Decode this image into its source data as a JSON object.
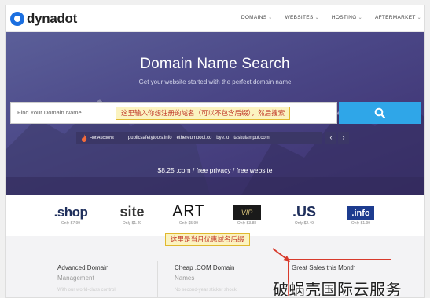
{
  "brand": {
    "name": "dynadot",
    "color": "#1b6fe0"
  },
  "nav": {
    "items": [
      {
        "label": "DOMAINS",
        "icon": "chevron-down-icon"
      },
      {
        "label": "WEBSITES",
        "icon": "chevron-down-icon"
      },
      {
        "label": "HOSTING",
        "icon": "chevron-down-icon"
      },
      {
        "label": "AFTERMARKET",
        "icon": "chevron-down-icon"
      }
    ]
  },
  "hero": {
    "title": "Domain Name Search",
    "subtitle": "Get your website started with the perfect domain name",
    "search": {
      "placeholder": "Find Your Domain Name",
      "annotation": "这里输入你想注册的域名（可以不包含后缀），然后搜索",
      "button_icon": "search-icon",
      "button_color": "#2fa6e8"
    },
    "auctions": {
      "label": "Hot Auctions",
      "icon": "flame-icon",
      "items": [
        "publicsafetytools.info",
        "ethereumpool.co",
        "bye.io",
        "taskulamput.com"
      ],
      "prev": "‹",
      "next": "›"
    },
    "promo": "$8.25 .com / free privacy / free website"
  },
  "tlds": [
    {
      "name": ".shop",
      "price": "Only $7.99"
    },
    {
      "name": "site",
      "price": "Only $1.49"
    },
    {
      "name": "ART",
      "price": "Only $5.99"
    },
    {
      "name": "VIP",
      "price": "Only $3.88"
    },
    {
      "name": ".US",
      "price": "Only $2.49"
    },
    {
      "name": ".info",
      "price": "Only $1.99"
    }
  ],
  "tld_annotation": "这里是当月优惠域名后缀",
  "features": [
    {
      "title": "Advanced Domain",
      "subtitle": "Management",
      "faint": "With our world-class control"
    },
    {
      "title": "Cheap .COM Domain",
      "subtitle": "Names",
      "faint": "No second-year sticker shock"
    },
    {
      "title": "Great Sales this Month",
      "subtitle": "",
      "faint": ""
    }
  ],
  "watermark": "破蜗壳国际云服务"
}
